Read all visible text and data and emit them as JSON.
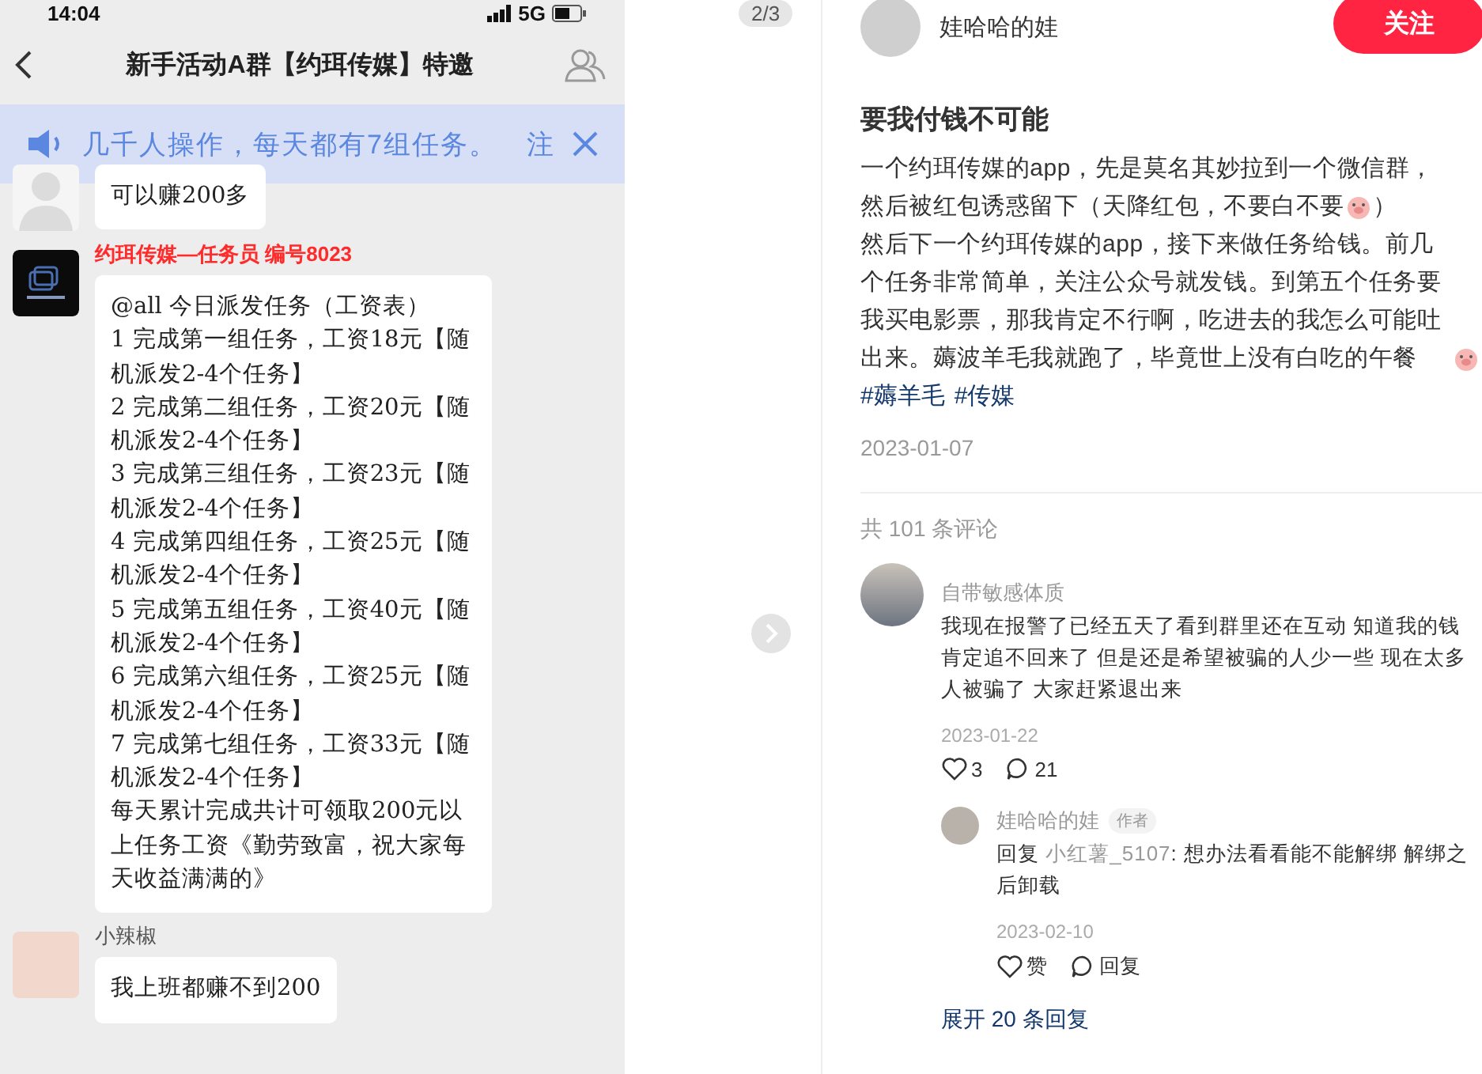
{
  "image_viewer": {
    "page_indicator": "2/3",
    "chat_screenshot": {
      "status_time": "14:04",
      "network": "5G",
      "title": "新手活动A群【约珥传媒】特邀",
      "notice": {
        "text": "几千人操作，每天都有7组任务。",
        "overflow": "注"
      },
      "messages": [
        {
          "kind": "silhouette",
          "lines": [
            "可以赚200多"
          ]
        },
        {
          "kind": "logo",
          "sender": "约珥传媒—任务员 编号8023",
          "color": "#ff2a2a",
          "lines": [
            "@all 今日派发任务（工资表）",
            "1 完成第一组任务，工资18元【随机派发2-4个任务】",
            "2 完成第二组任务，工资20元【随机派发2-4个任务】",
            "3 完成第三组任务，工资23元【随机派发2-4个任务】",
            "4 完成第四组任务，工资25元【随机派发2-4个任务】",
            "5 完成第五组任务，工资40元【随机派发2-4个任务】",
            "6 完成第六组任务，工资25元【随机派发2-4个任务】",
            "7 完成第七组任务，工资33元【随机派发2-4个任务】",
            "每天累计完成共计可领取200元以上任务工资《勤劳致富，祝大家每天收益满满的》"
          ]
        },
        {
          "kind": "photo",
          "sender": "小辣椒",
          "color": "#555555",
          "lines": [
            "我上班都赚不到200"
          ]
        }
      ]
    }
  },
  "note": {
    "author": "娃哈哈的娃",
    "follow_button": "关注",
    "title": "要我付钱不可能",
    "body": [
      [
        {
          "kind": "text",
          "text": "一个约珥传媒的app，先是莫名其妙拉到一个微信群，"
        }
      ],
      [
        {
          "kind": "text",
          "text": "然后被红包诱惑留下（天降红包，不要白不要"
        },
        {
          "kind": "emoji"
        },
        {
          "kind": "text",
          "text": "）"
        }
      ],
      [
        {
          "kind": "text",
          "text": "然后下一个约珥传媒的app，接下来做任务给钱。前几个任务非常简单，关注公众号就发钱。到第五个任务要我买电影票，那我肯定不行啊，吃进去的我怎么可能吐出来。薅波羊毛我就跑了，毕竟世上没有白吃的午餐"
        },
        {
          "kind": "emoji"
        }
      ]
    ],
    "tags": [
      "#薅羊毛",
      "#传媒"
    ],
    "date": "2023-01-07"
  },
  "comments": {
    "count": "共 101 条评论",
    "items": [
      {
        "author": "自带敏感体质",
        "text": "我现在报警了已经五天了看到群里还在互动 知道我的钱肯定追不回来了 但是还是希望被骗的人少一些 现在太多人被骗了 大家赶紧退出来",
        "date": "2023-01-22",
        "likes": "3",
        "replies": "21",
        "sub_replies": [
          {
            "author": "娃哈哈的娃",
            "badge": "作者",
            "prefix": "回复",
            "target": "小红薯_5107",
            "text": ": 想办法看看能不能解绑 解绑之后卸载",
            "date": "2023-02-10",
            "likes": "赞",
            "replies": "回复"
          }
        ],
        "expand": "展开 20 条回复"
      }
    ]
  }
}
